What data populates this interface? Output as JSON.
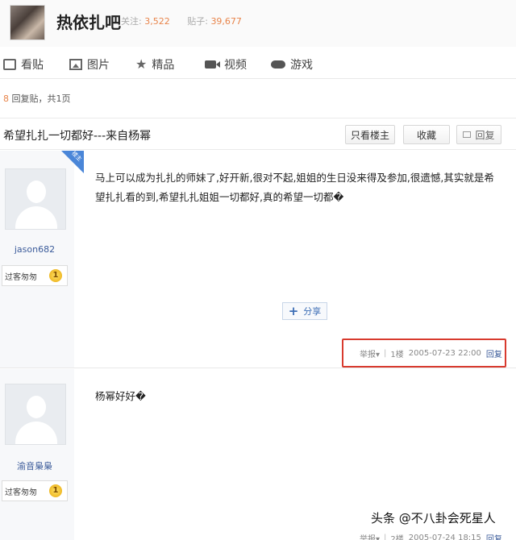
{
  "header": {
    "forum_name": "热依扎吧",
    "follow_label": "关注:",
    "follow_count": "3,522",
    "posts_label": "贴子:",
    "posts_count": "39,677"
  },
  "nav": {
    "items": [
      {
        "label": "看贴",
        "icon": "post-icon"
      },
      {
        "label": "图片",
        "icon": "picture-icon"
      },
      {
        "label": "精品",
        "icon": "star-icon"
      },
      {
        "label": "视频",
        "icon": "video-icon"
      },
      {
        "label": "游戏",
        "icon": "gamepad-icon"
      }
    ]
  },
  "reply_info": {
    "count": "8",
    "text": " 回复贴，共1页"
  },
  "thread": {
    "title": "希望扎扎一切都好---来自杨幂",
    "only_op_label": "只看楼主",
    "favorite_label": "收藏",
    "reply_label": "回复"
  },
  "posts": [
    {
      "badge": "楼主",
      "username": "jason682",
      "level_name": "过客匆匆",
      "level": "1",
      "content": "马上可以成为扎扎的师妹了,好开新,很对不起,姐姐的生日没来得及参加,很遗憾,其实就是希望扎扎看的到,希望扎扎姐姐一切都好,真的希望一切都�",
      "share_label": "分享",
      "report_label": "举报▾",
      "floor": "1楼",
      "datetime": "2005-07-23 22:00",
      "reply_label": "回复"
    },
    {
      "username": "渝音梟梟",
      "level_name": "过客匆匆",
      "level": "1",
      "content": "杨幂好好�",
      "report_label": "举报▾",
      "floor": "2楼",
      "datetime": "2005-07-24 18:15",
      "reply_label": "回复"
    }
  ],
  "watermark": "头条 @不八卦会死星人",
  "colors": {
    "accent_orange": "#e8844a",
    "link_blue": "#3b5b9a",
    "highlight_red": "#d83a2e",
    "corner_blue": "#4a86d8"
  }
}
